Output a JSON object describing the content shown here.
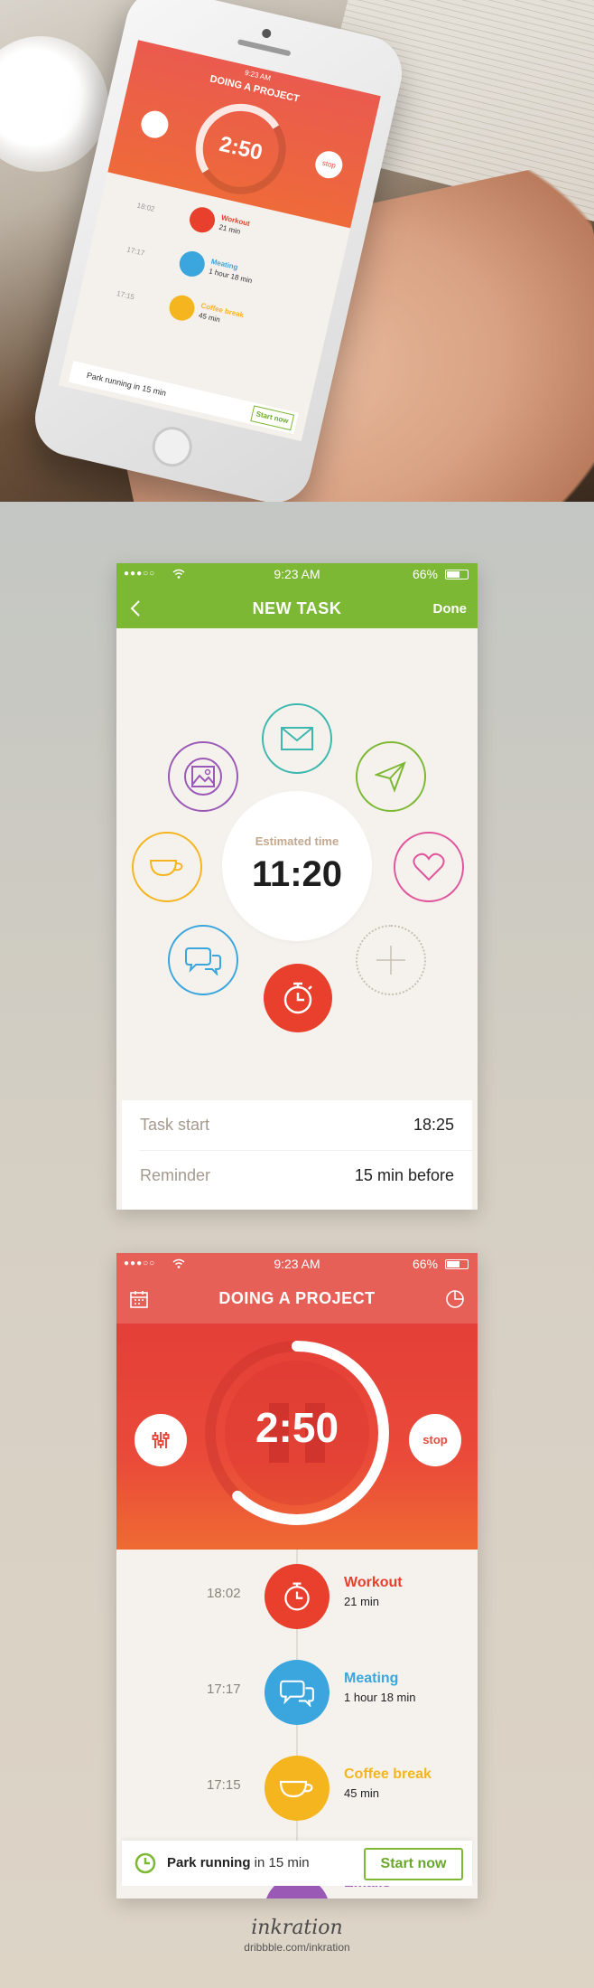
{
  "hero": {
    "status_time": "9:23 AM",
    "title": "DOING A PROJECT",
    "timer": "2:50",
    "stop_label": "stop",
    "tasks": [
      {
        "time": "18:02",
        "name": "Workout",
        "duration": "21 min"
      },
      {
        "time": "17:17",
        "name": "Meating",
        "duration": "1 hour 18 min"
      },
      {
        "time": "17:15",
        "name": "Coffee break",
        "duration": "45 min"
      }
    ],
    "banner_text": "Park running in 15 min",
    "start_label": "Start now"
  },
  "new_task": {
    "status": {
      "time": "9:23 AM",
      "battery": "66%"
    },
    "title": "NEW TASK",
    "done_label": "Done",
    "estimated_label": "Estimated time",
    "estimated_value": "11:20",
    "icons": [
      "picture-icon",
      "mail-icon",
      "send-icon",
      "heart-icon",
      "plus-icon",
      "timer-icon",
      "chat-icon",
      "cup-icon"
    ],
    "settings": [
      {
        "key": "Task start",
        "value": "18:25"
      },
      {
        "key": "Reminder",
        "value": "15 min before"
      }
    ]
  },
  "doing": {
    "status": {
      "time": "9:23 AM",
      "battery": "66%"
    },
    "title": "DOING A PROJECT",
    "timer": "2:50",
    "stop_label": "stop",
    "progress_fraction": 0.62,
    "tasks": [
      {
        "time": "18:02",
        "name": "Workout",
        "duration": "21 min",
        "color": "#e8402c",
        "icon": "stopwatch-icon"
      },
      {
        "time": "17:17",
        "name": "Meating",
        "duration": "1 hour 18 min",
        "color": "#3aa6dd",
        "icon": "chat-icon"
      },
      {
        "time": "17:15",
        "name": "Coffee break",
        "duration": "45 min",
        "color": "#f5b51f",
        "icon": "cup-icon"
      }
    ],
    "banner": {
      "prefix": "Park running",
      "suffix": " in 15 min",
      "start_label": "Start now"
    },
    "peek_label": "Emails"
  },
  "footer": {
    "signature": "inkration",
    "url": "dribbble.com/inkration"
  },
  "colors": {
    "green": "#7cb834",
    "red": "#e66058",
    "purple": "#9b59b6",
    "blue": "#3aa6dd",
    "yellow": "#f5b51f",
    "pink": "#e0559b",
    "orange": "#f28b2c"
  }
}
